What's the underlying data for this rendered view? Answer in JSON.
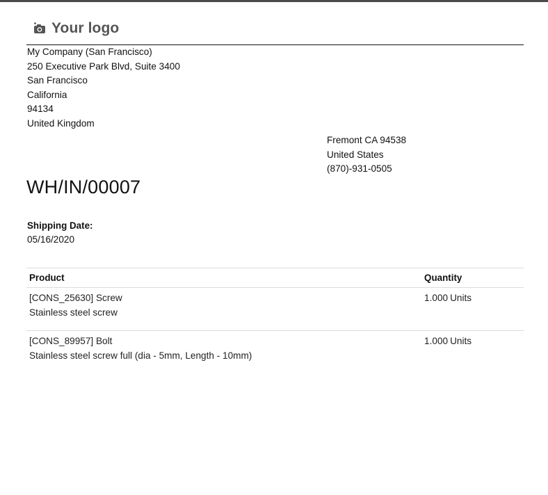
{
  "logo": {
    "text": "Your logo",
    "icon": "camera-icon"
  },
  "company": {
    "lines": [
      "My Company (San Francisco)",
      "250 Executive Park Blvd, Suite 3400",
      "San Francisco",
      "California",
      "94134",
      "United Kingdom"
    ]
  },
  "partner": {
    "lines": [
      "Fremont CA 94538",
      "United States",
      "(870)-931-0505"
    ]
  },
  "document": {
    "title": "WH/IN/00007",
    "shipping_date_label": "Shipping Date:",
    "shipping_date": "05/16/2020"
  },
  "table": {
    "headers": {
      "product": "Product",
      "quantity": "Quantity"
    },
    "rows": [
      {
        "product": "[CONS_25630] Screw",
        "description": "Stainless steel screw",
        "qty": "1.000",
        "unit": "Units"
      },
      {
        "product": "[CONS_89957] Bolt",
        "description": "Stainless steel screw full (dia - 5mm, Length - 10mm)",
        "qty": "1.000",
        "unit": "Units"
      }
    ]
  },
  "colors": {
    "top_bar": "#4a4a4a",
    "logo_text": "#555555",
    "rule": "#111111",
    "table_border": "#dcdcdc"
  }
}
